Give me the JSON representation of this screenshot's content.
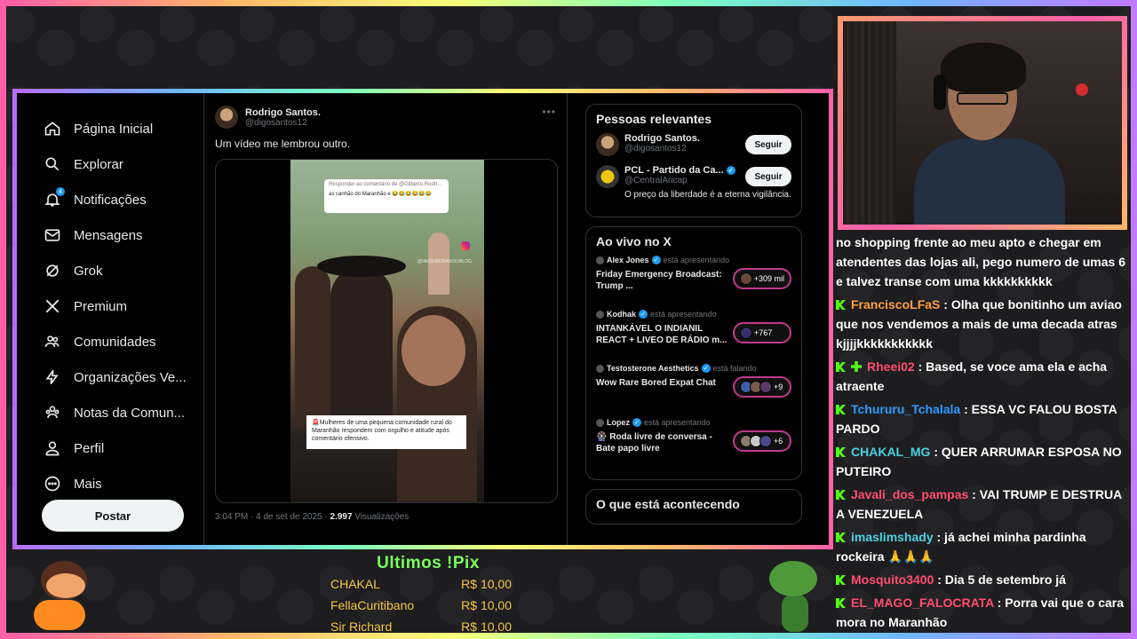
{
  "nav": {
    "items": [
      {
        "label": "Página Inicial",
        "icon": "home-icon"
      },
      {
        "label": "Explorar",
        "icon": "search-icon"
      },
      {
        "label": "Notificações",
        "icon": "bell-icon",
        "badge": "4"
      },
      {
        "label": "Mensagens",
        "icon": "mail-icon"
      },
      {
        "label": "Grok",
        "icon": "grok-icon"
      },
      {
        "label": "Premium",
        "icon": "x-logo-icon"
      },
      {
        "label": "Comunidades",
        "icon": "people-icon"
      },
      {
        "label": "Organizações Ve...",
        "icon": "lightning-icon"
      },
      {
        "label": "Notas da Comun...",
        "icon": "community-notes-icon"
      },
      {
        "label": "Perfil",
        "icon": "person-icon"
      },
      {
        "label": "Mais",
        "icon": "more-circle-icon"
      }
    ],
    "post_button": "Postar"
  },
  "tweet": {
    "author_name": "Rodrigo Santos.",
    "author_handle": "@digosantos12",
    "text": "Um vídeo me lembrou outro.",
    "video_comment_header": "Responder ao comentário de @Gilberto Rodri...",
    "video_comment_text": "as canhão do Maranhão e 😂😂😂😂😂😂",
    "video_watermark": "@VAIDEMORANDO.BLOG",
    "video_caption": "🚨Mulheres de uma pequena comunidade rural do Maranhão respondem com orgulho e atitude após comentário ofensivo.",
    "timestamp": "3:04 PM · 4 de set de 2025 · ",
    "views_count": "2.997",
    "views_label": " Visualizações"
  },
  "relevant": {
    "title": "Pessoas relevantes",
    "follow_label": "Seguir",
    "people": [
      {
        "name": "Rodrigo Santos.",
        "handle": "@digosantos12",
        "bio": ""
      },
      {
        "name": "PCL - Partido da Ca...",
        "handle": "@CentralAncap",
        "bio": "O preço da liberdade é a eterna vigilância."
      }
    ]
  },
  "live": {
    "title": "Ao vivo no X",
    "items": [
      {
        "host": "Alex Jones",
        "status": "está apresentando",
        "title": "Friday Emergency Broadcast: Trump ...",
        "count": "+309 mil"
      },
      {
        "host": "Kodhak",
        "status": "está apresentando",
        "title": "INTANKÁVEL O INDIANIL REACT + LIVEO DE RÁDIO  m...",
        "count": "+767"
      },
      {
        "host": "Testosterone Aesthetics",
        "status": "está falando",
        "title": "Wow Rare Bored Expat Chat",
        "count": "+9"
      },
      {
        "host": "Lopez",
        "status": "está apresentando",
        "title": "🎡 Roda livre de conversa - Bate papo livre",
        "count": "+6"
      }
    ]
  },
  "trending_title": "O que está acontecendo",
  "chat": {
    "first_text": "no shopping frente ao meu apto e chegar em atendentes das lojas ali, pego numero de umas 6 e talvez transe com uma kkkkkkkkkk",
    "messages": [
      {
        "user": "FranciscoLFaS",
        "text": " : Olha que bonitinho um aviao que nos vendemos a mais de uma decada atras kjjjjkkkkkkkkkkk"
      },
      {
        "user": "Rheei02",
        "text": " : Based, se voce ama ela e acha atraente"
      },
      {
        "user": "Tchururu_Tchalala",
        "text": " : ESSA VC FALOU BOSTA PARDO"
      },
      {
        "user": "CHAKAL_MG",
        "text": " : QUER ARRUMAR ESPOSA NO PUTEIRO"
      },
      {
        "user": "Javali_dos_pampas",
        "text": " : VAI TRUMP E DESTRUA A VENEZUELA"
      },
      {
        "user": "imaslimshady",
        "text": " : já achei minha pardinha rockeira 🙏🙏🙏"
      },
      {
        "user": "Mosquito3400",
        "text": " : Dia 5 de setembro já"
      },
      {
        "user": "EL_MAGO_FALOCRATA",
        "text": " : Porra vai que o cara mora no Maranhão"
      }
    ]
  },
  "pix": {
    "title": "Ultimos !Pix",
    "rows": [
      {
        "name": "CHAKAL",
        "amount": "R$ 10,00"
      },
      {
        "name": "FellaCuritibano",
        "amount": "R$ 10,00"
      },
      {
        "name": "Sir Richard",
        "amount": "R$ 10,00"
      }
    ]
  },
  "colors": {
    "accent_blue": "#1d9bf0",
    "kick_green": "#53fc18",
    "pix_title": "#7aff5c",
    "pix_text": "#f5c542"
  }
}
